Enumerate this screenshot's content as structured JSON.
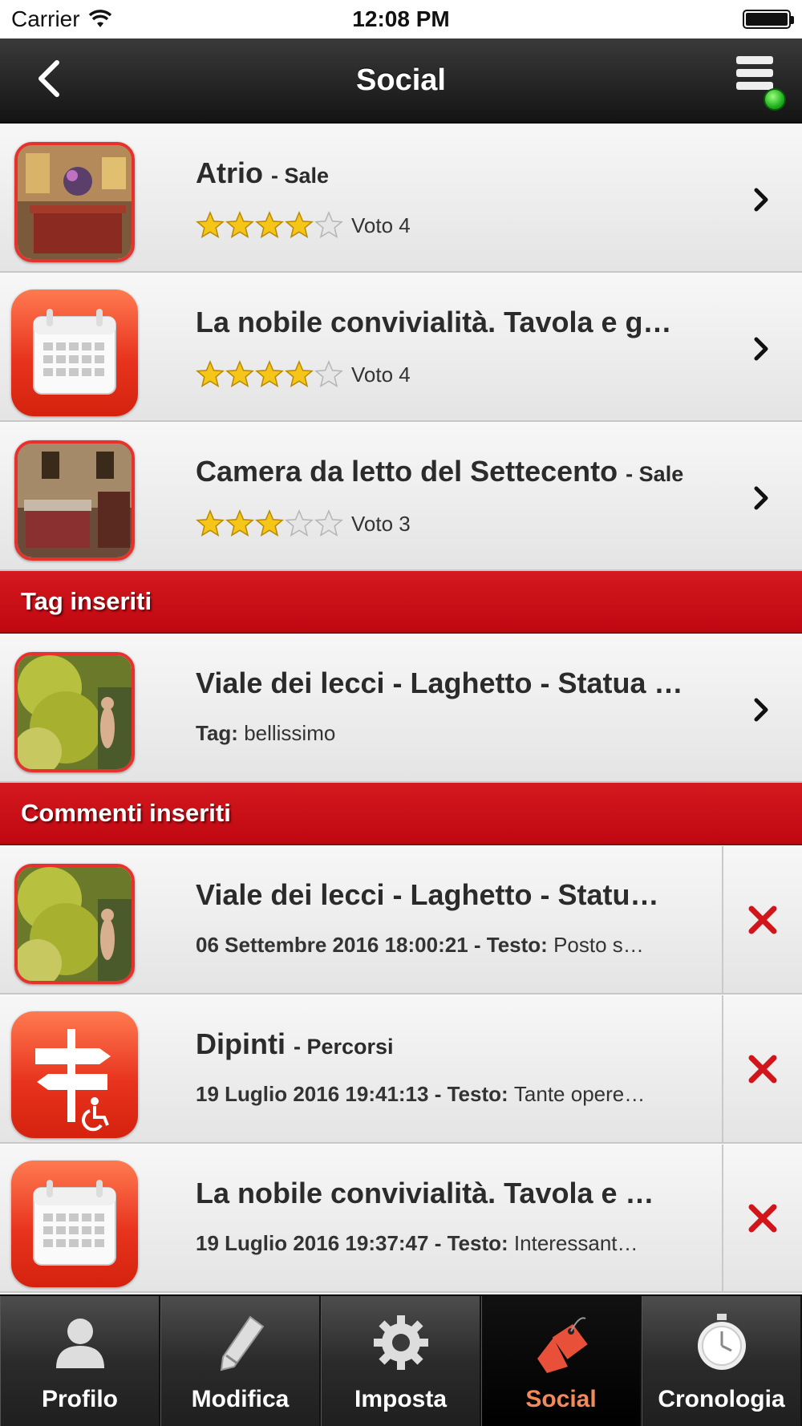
{
  "status_bar": {
    "carrier": "Carrier",
    "time": "12:08 PM"
  },
  "nav": {
    "title": "Social",
    "back_icon": "chevron-left-icon",
    "menu_icon": "menu-online-icon"
  },
  "ratings": [
    {
      "title": "Atrio",
      "category": "- Sale",
      "stars": 4,
      "vote_label": "Voto 4",
      "thumb": "room-photo"
    },
    {
      "title": "La nobile convivialità. Tavola e g…",
      "category": "",
      "stars": 4,
      "vote_label": "Voto 4",
      "thumb": "calendar-icon"
    },
    {
      "title": "Camera da letto del Settecento",
      "category": "- Sale",
      "stars": 3,
      "vote_label": "Voto 3",
      "thumb": "room-photo"
    }
  ],
  "sections": {
    "tags": "Tag inseriti",
    "comments": "Commenti inseriti"
  },
  "tags": [
    {
      "title": "Viale dei lecci - Laghetto - Statua …",
      "tag_label": "Tag:",
      "tag_value": "bellissimo",
      "thumb": "garden-photo"
    }
  ],
  "comments": [
    {
      "title": "Viale dei lecci - Laghetto - Statu…",
      "category": "",
      "date": "06 Settembre 2016 18:00:21 - Testo:",
      "text": "Posto s…",
      "thumb": "garden-photo"
    },
    {
      "title": "Dipinti",
      "category": "- Percorsi",
      "date": "19 Luglio 2016 19:41:13 - Testo:",
      "text": "Tante opere…",
      "thumb": "signpost-icon"
    },
    {
      "title": "La nobile convivialità. Tavola e …",
      "category": "",
      "date": "19 Luglio 2016 19:37:47 - Testo:",
      "text": "Interessant…",
      "thumb": "calendar-icon"
    }
  ],
  "tabs": [
    {
      "label": "Profilo",
      "icon": "person-icon",
      "active": false
    },
    {
      "label": "Modifica",
      "icon": "pencil-icon",
      "active": false
    },
    {
      "label": "Imposta",
      "icon": "gear-icon",
      "active": false
    },
    {
      "label": "Social",
      "icon": "tag-icon",
      "active": true
    },
    {
      "label": "Cronologia",
      "icon": "stopwatch-icon",
      "active": false
    }
  ],
  "colors": {
    "accent_red": "#c8070f",
    "active_tab_label": "#f28a5a",
    "delete_red": "#d0151b",
    "star_gold": "#f5c518"
  }
}
